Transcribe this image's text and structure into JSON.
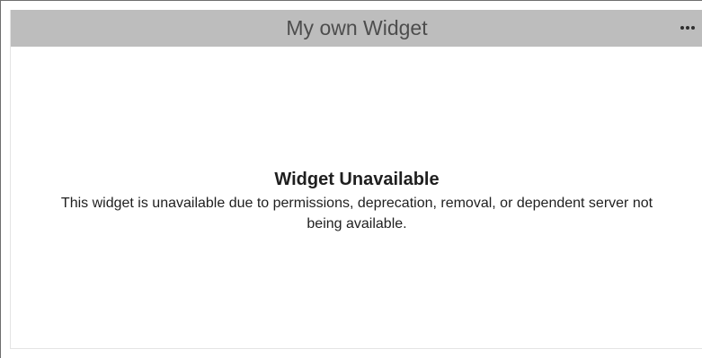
{
  "widget": {
    "title": "My own Widget",
    "menu_icon": "more-horizontal-icon",
    "unavailable_title": "Widget Unavailable",
    "unavailable_message": "This widget is unavailable due to permissions, deprecation, removal, or dependent server not being available."
  },
  "colors": {
    "header_background": "#bdbdbd",
    "title_text": "#4d4d4d",
    "body_text": "#1f1f1f"
  }
}
